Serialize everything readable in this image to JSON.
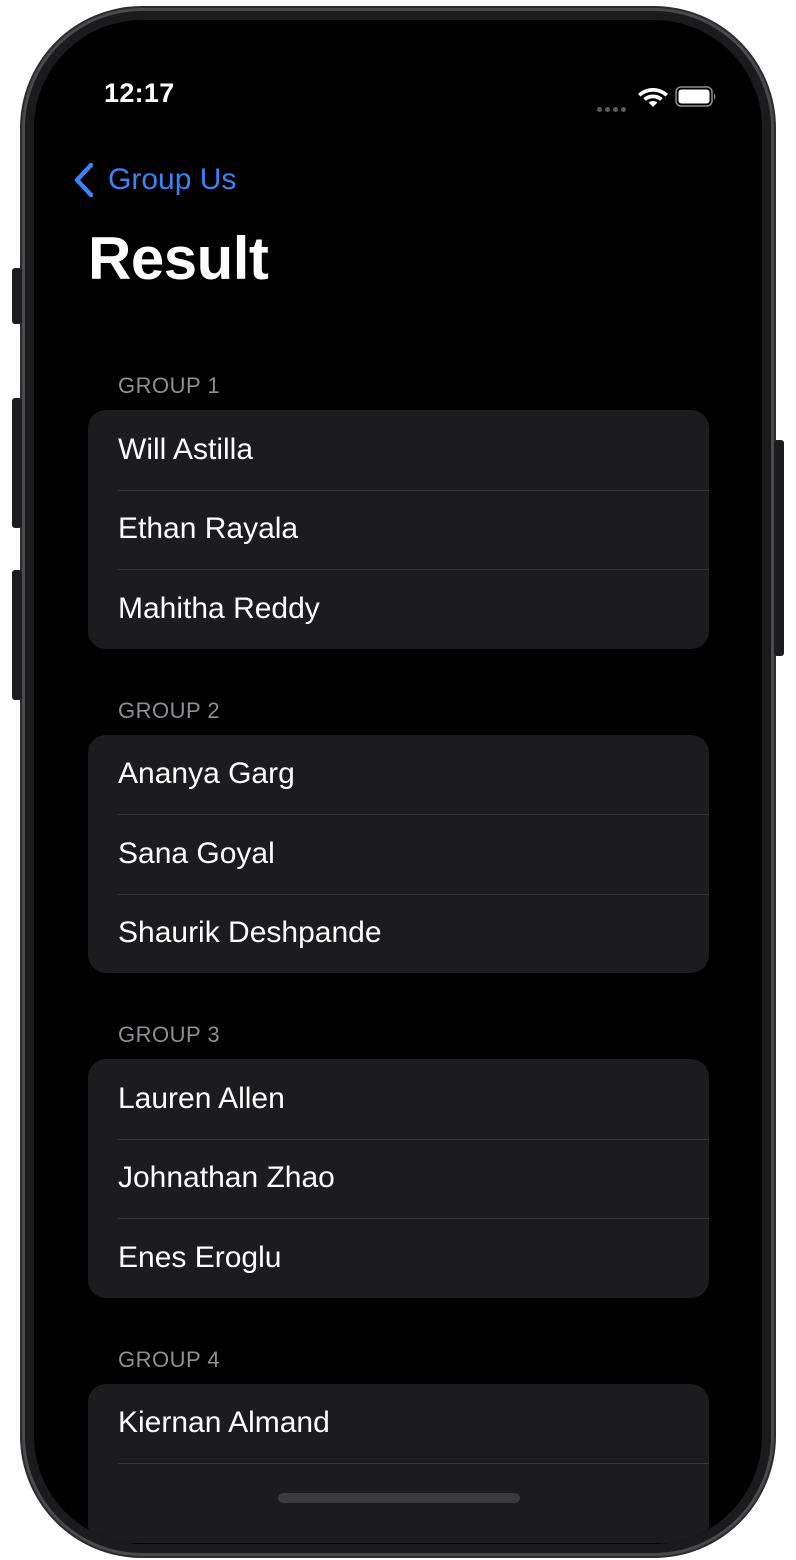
{
  "status_bar": {
    "time": "12:17",
    "icons": [
      "cellular-signal-icon",
      "wifi-icon",
      "battery-icon"
    ]
  },
  "nav": {
    "back_label": "Group Us",
    "accent_color": "#3b82f6"
  },
  "title": "Result",
  "groups": [
    {
      "header": "GROUP 1",
      "members": [
        "Will Astilla",
        "Ethan Rayala",
        "Mahitha Reddy"
      ]
    },
    {
      "header": "GROUP 2",
      "members": [
        "Ananya Garg",
        "Sana Goyal",
        "Shaurik Deshpande"
      ]
    },
    {
      "header": "GROUP 3",
      "members": [
        "Lauren Allen",
        "Johnathan Zhao",
        "Enes Eroglu"
      ]
    },
    {
      "header": "GROUP 4",
      "members": [
        "Kiernan Almand"
      ]
    }
  ]
}
